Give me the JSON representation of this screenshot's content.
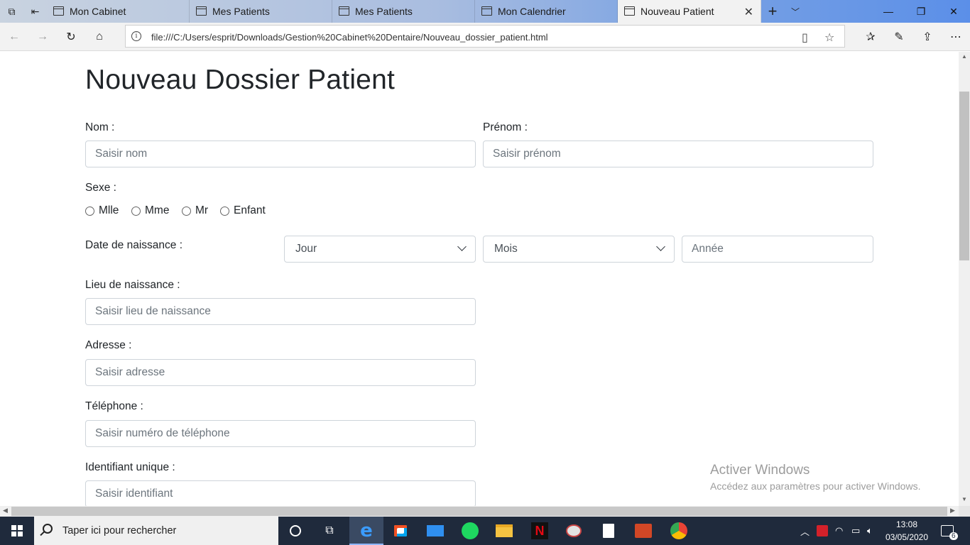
{
  "browser": {
    "tabs": [
      {
        "label": "Mon Cabinet"
      },
      {
        "label": "Mes Patients"
      },
      {
        "label": "Mes Patients"
      },
      {
        "label": "Mon Calendrier"
      },
      {
        "label": "Nouveau Patient"
      }
    ],
    "url": "file:///C:/Users/esprit/Downloads/Gestion%20Cabinet%20Dentaire/Nouveau_dossier_patient.html"
  },
  "form": {
    "title": "Nouveau Dossier Patient",
    "nom": {
      "label": "Nom :",
      "placeholder": "Saisir nom"
    },
    "prenom": {
      "label": "Prénom :",
      "placeholder": "Saisir prénom"
    },
    "sexe": {
      "label": "Sexe :",
      "options": [
        "Mlle",
        "Mme",
        "Mr",
        "Enfant"
      ]
    },
    "naissance": {
      "label": "Date de naissance :",
      "jour": "Jour",
      "mois": "Mois",
      "annee_placeholder": "Année"
    },
    "lieu": {
      "label": "Lieu de naissance :",
      "placeholder": "Saisir lieu de naissance"
    },
    "adresse": {
      "label": "Adresse :",
      "placeholder": "Saisir adresse"
    },
    "telephone": {
      "label": "Téléphone :",
      "placeholder": "Saisir numéro de téléphone"
    },
    "identifiant": {
      "label": "Identifiant unique :",
      "placeholder": "Saisir identifiant"
    }
  },
  "watermark": {
    "title": "Activer Windows",
    "subtitle": "Accédez aux paramètres pour activer Windows."
  },
  "taskbar": {
    "search_placeholder": "Taper ici pour rechercher",
    "time": "13:08",
    "date": "03/05/2020",
    "notification_count": "6"
  }
}
